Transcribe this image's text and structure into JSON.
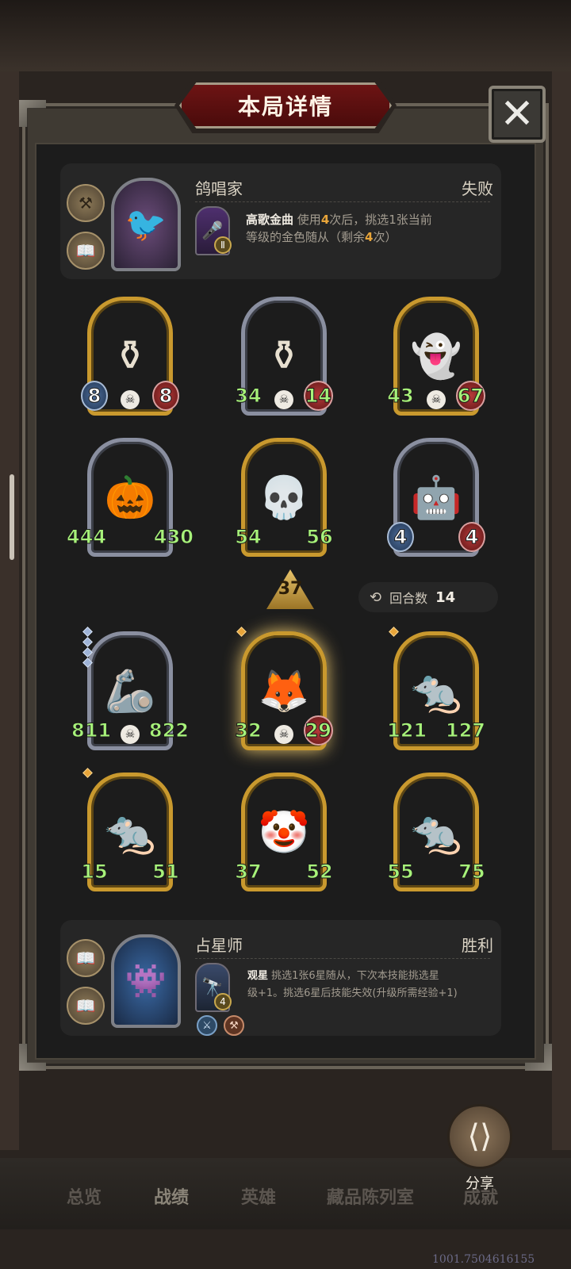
{
  "header": {
    "title": "本局详情"
  },
  "opponent": {
    "name": "鸽唱家",
    "result": "失败",
    "skill_name": "高歌金曲",
    "skill_desc_1": "使用",
    "skill_num_1": "4",
    "skill_desc_2": "次后，挑选1张当前",
    "skill_desc_3": "等级的金色随从（剩余",
    "skill_num_2": "4",
    "skill_desc_4": "次）",
    "skill_badge": "Ⅱ"
  },
  "enemy_units": [
    {
      "atk": "8",
      "hp": "8"
    },
    {
      "atk": "34",
      "hp": "14"
    },
    {
      "atk": "43",
      "hp": "67"
    },
    {
      "atk": "444",
      "hp": "430"
    },
    {
      "atk": "54",
      "hp": "56"
    },
    {
      "atk": "4",
      "hp": "4"
    }
  ],
  "level_badge": "37",
  "rounds": {
    "label": "回合数",
    "value": "14"
  },
  "player_units": [
    {
      "atk": "811",
      "hp": "822"
    },
    {
      "atk": "32",
      "hp": "29"
    },
    {
      "atk": "121",
      "hp": "127"
    },
    {
      "atk": "15",
      "hp": "51"
    },
    {
      "atk": "37",
      "hp": "52"
    },
    {
      "atk": "55",
      "hp": "75"
    }
  ],
  "self": {
    "name": "占星师",
    "result": "胜利",
    "skill_name": "观星",
    "skill_desc_line1": "挑选1张6星随从，下次本技能挑选星",
    "skill_desc_line2": "级+1。挑选6星后技能失效(升级所需经验+1)",
    "skill_badge": "4"
  },
  "share": {
    "label": "分享"
  },
  "nav": [
    "总览",
    "战绩",
    "英雄",
    "藏品陈列室",
    "成就"
  ],
  "footer_id": "1001.7504616155"
}
